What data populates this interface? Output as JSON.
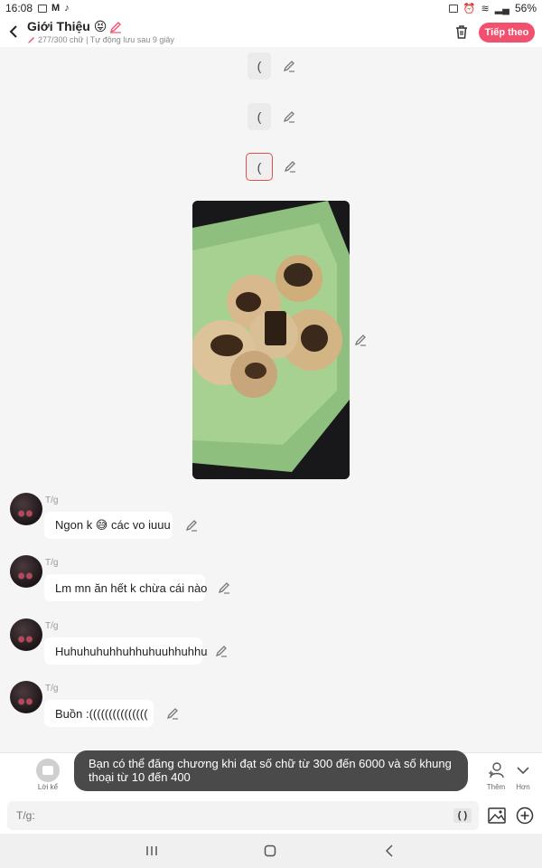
{
  "status_bar": {
    "time": "16:08",
    "battery": "56%"
  },
  "header": {
    "title": "Giới Thiệu 😝",
    "subtitle": "277/300 chữ | Tự động lưu sau 9 giây",
    "next_label": "Tiếp theo"
  },
  "chips": [
    {
      "label": "("
    },
    {
      "label": "("
    },
    {
      "label": "("
    }
  ],
  "image": {
    "description_icon": "photo"
  },
  "messages": [
    {
      "speaker": "T/g",
      "text": "Ngon k 😅 các vo iuuu"
    },
    {
      "speaker": "T/g",
      "text": "Lm mn ăn hết k chừa cái nào"
    },
    {
      "speaker": "T/g",
      "text": "Huhuhuhuhhuhhuhuuhhuhhu"
    },
    {
      "speaker": "T/g",
      "text": "Buồn :((((((((((((((("
    }
  ],
  "toolbar": {
    "narration": "Lời kể",
    "add_more": "Thêm",
    "more": "Hơn"
  },
  "toast": {
    "text": "Bạn có thể đăng chương khi đạt số chữ từ 300 đến 6000 và số khung thoại từ 10 đến 400"
  },
  "input": {
    "placeholder": "T/g:",
    "paren_label": "( )"
  },
  "colors": {
    "accent": "#f2506e",
    "selected_chip_border": "#e05050",
    "toast_bg": "#4a4a4a"
  }
}
